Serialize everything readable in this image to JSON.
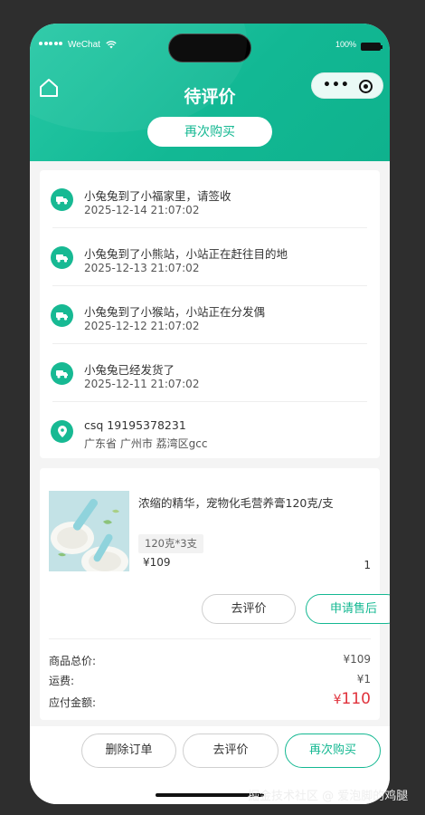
{
  "status_bar": {
    "carrier": "WeChat",
    "wifi_icon": "wifi-icon",
    "battery_text": "100%"
  },
  "nav": {
    "title": "待评价",
    "home_icon": "home-icon",
    "capsule_more_icon": "more-dots-icon",
    "capsule_close_icon": "target-close-icon"
  },
  "header_button": {
    "label": "再次购买"
  },
  "logistics": {
    "items": [
      {
        "icon": "truck-icon",
        "text": "小兔兔到了小福家里，请签收",
        "time": "2025-12-14 21:07:02"
      },
      {
        "icon": "truck-icon",
        "text": "小兔兔到了小熊站，小站正在赶往目的地",
        "time": "2025-12-13 21:07:02"
      },
      {
        "icon": "truck-icon",
        "text": "小兔兔到了小猴站，小站正在分发偶",
        "time": "2025-12-12 21:07:02"
      },
      {
        "icon": "truck-icon",
        "text": "小兔兔已经发货了",
        "time": "2025-12-11 21:07:02"
      }
    ],
    "address": {
      "icon": "location-pin-icon",
      "contact": "csq 19195378231",
      "detail": "广东省 广州市 荔湾区gcc"
    }
  },
  "order": {
    "product": {
      "name": "浓缩的精华，宠物化毛营养膏120克/支",
      "spec": "120克*3支",
      "price": "¥109",
      "quantity": "1"
    },
    "actions": {
      "review": "去评价",
      "after_sale": "申请售后"
    },
    "summary": {
      "goods_total_label": "商品总价:",
      "goods_total_value": "¥109",
      "shipping_label": "运费:",
      "shipping_value": "¥1",
      "payable_label": "应付金额:",
      "payable_currency": "¥",
      "payable_value": "110"
    }
  },
  "bottom_bar": {
    "delete_order": "删除订单",
    "review": "去评价",
    "buy_again": "再次购买"
  },
  "watermark": "掘金技术社区 @ 爱泡脚的鸡腿",
  "colors": {
    "primary": "#14b892",
    "header_gradient_start": "#27c9a6",
    "price_red": "#e0323c",
    "page_bg": "#2e2e2e"
  }
}
